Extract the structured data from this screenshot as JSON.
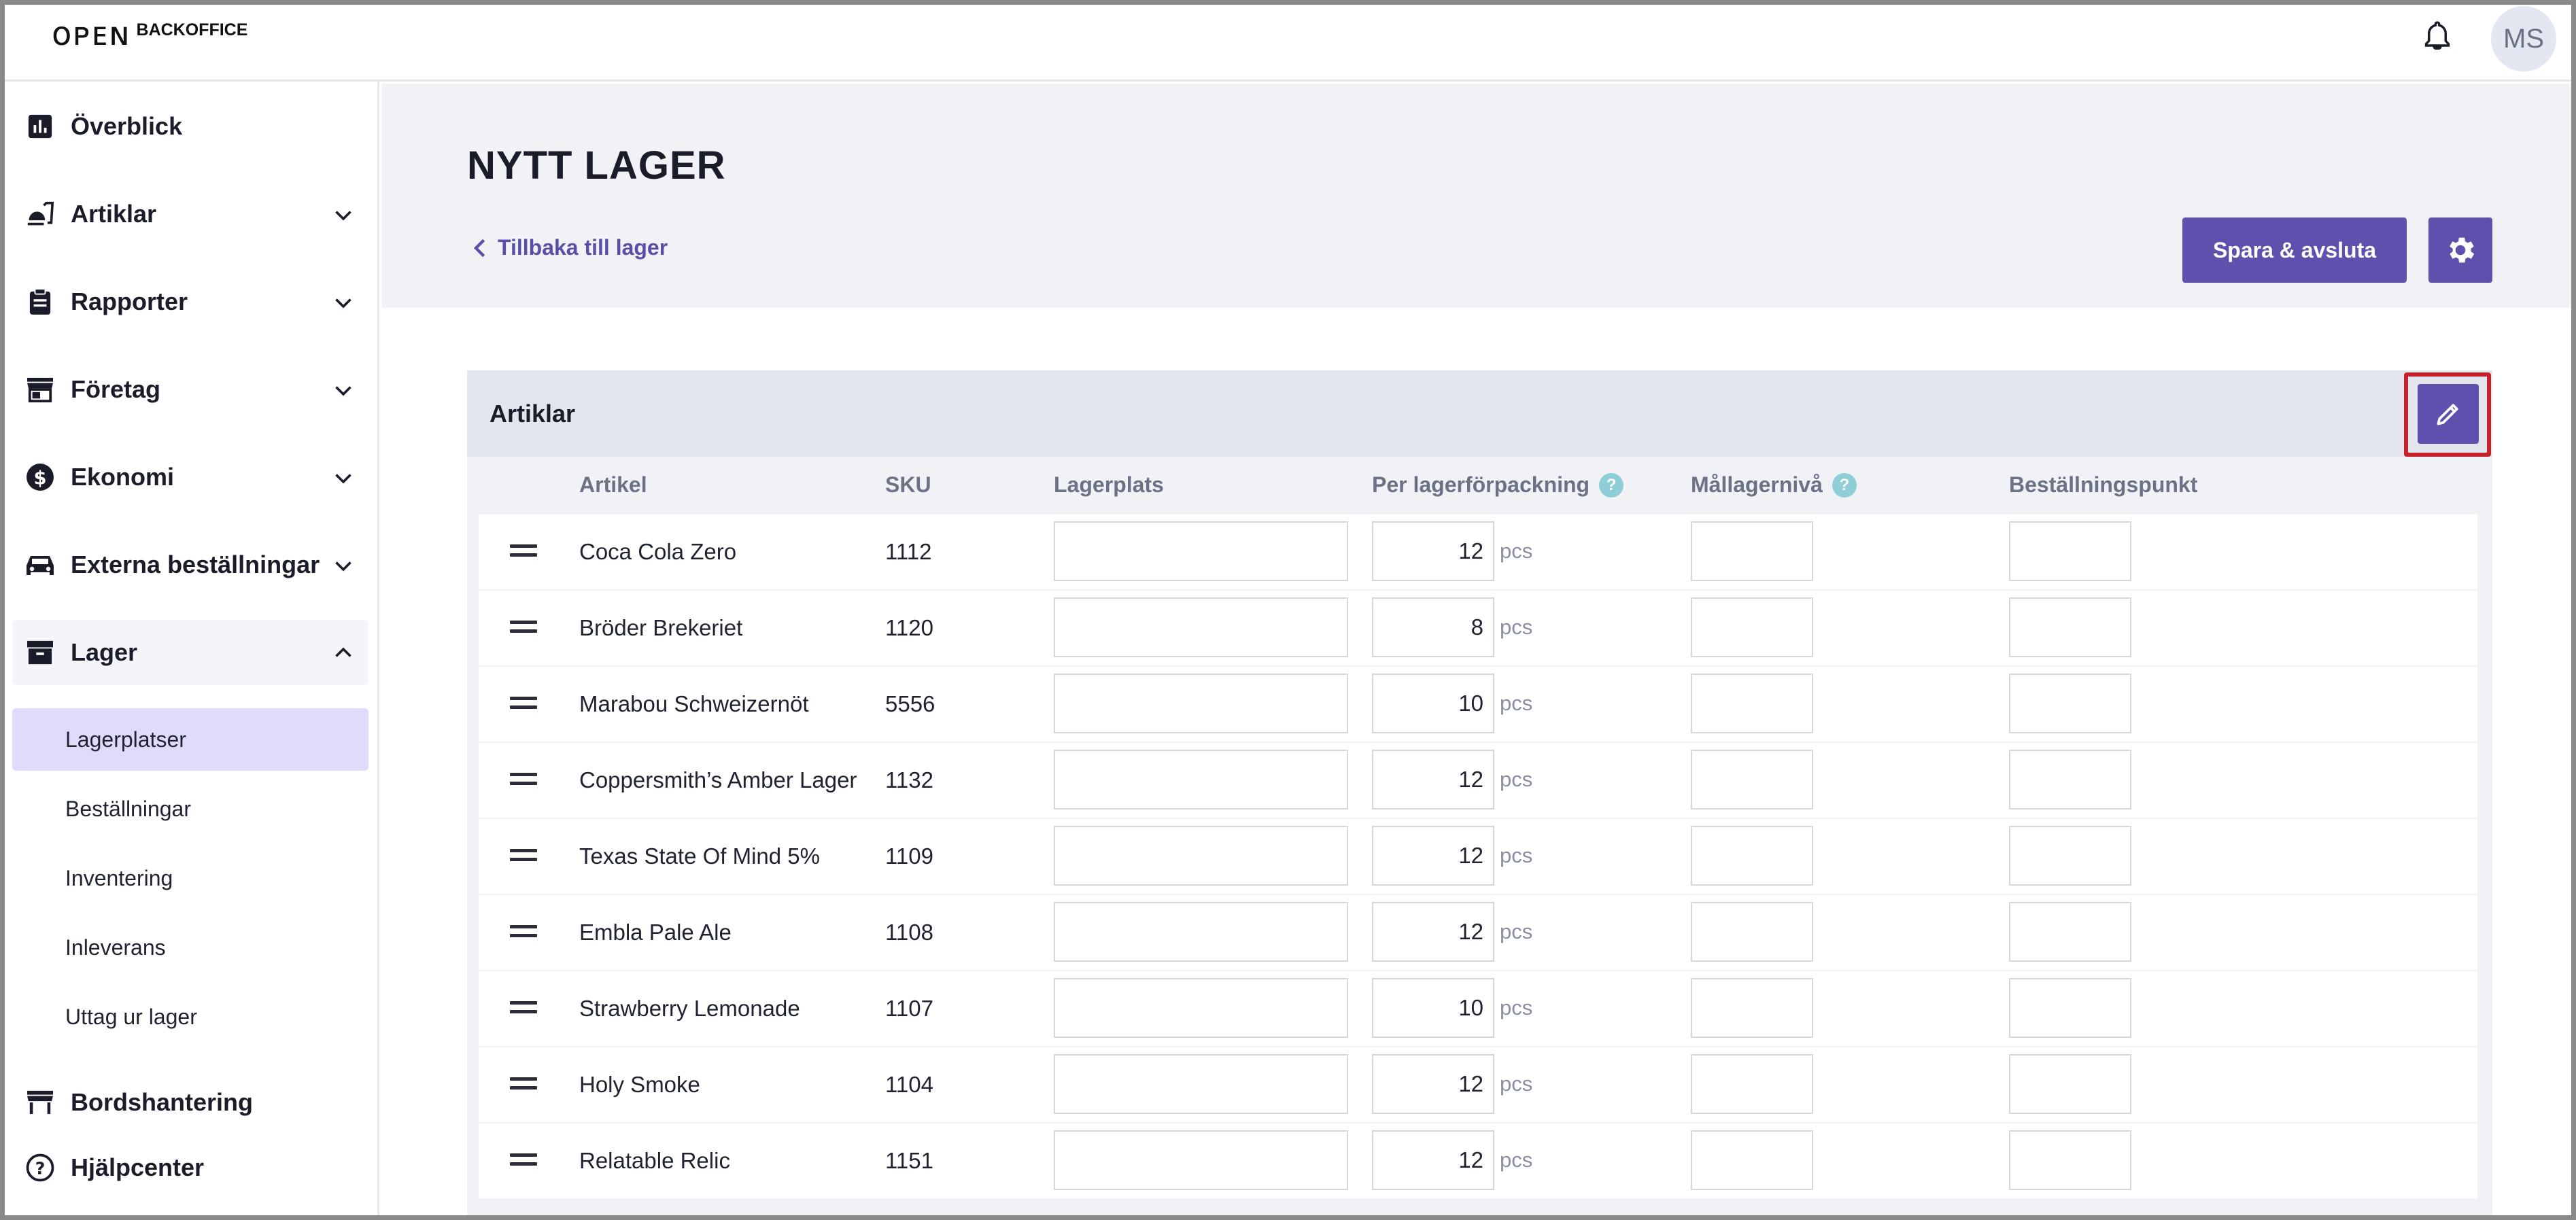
{
  "header": {
    "logo_mark": "ᴏᴘᴇɴ",
    "logo_text": "BACKOFFICE",
    "avatar_initials": "MS"
  },
  "sidebar": {
    "items": [
      {
        "label": "Överblick",
        "icon": "chart-icon"
      },
      {
        "label": "Artiklar",
        "icon": "food-icon"
      },
      {
        "label": "Rapporter",
        "icon": "clipboard-icon"
      },
      {
        "label": "Företag",
        "icon": "store-icon"
      },
      {
        "label": "Ekonomi",
        "icon": "dollar-icon"
      },
      {
        "label": "Externa beställningar",
        "icon": "car-icon"
      },
      {
        "label": "Lager",
        "icon": "archive-icon"
      }
    ],
    "lager_sub": [
      "Lagerplatser",
      "Beställningar",
      "Inventering",
      "Inleverans",
      "Uttag ur lager"
    ],
    "bottom": [
      {
        "label": "Bordshantering",
        "icon": "table-icon"
      },
      {
        "label": "Hjälpcenter",
        "icon": "help-icon"
      }
    ]
  },
  "page": {
    "title": "NYTT LAGER",
    "back_label": "Tillbaka till lager",
    "save_label": "Spara & avsluta"
  },
  "card": {
    "title": "Artiklar",
    "columns": {
      "article": "Artikel",
      "sku": "SKU",
      "location": "Lagerplats",
      "per_pack": "Per lagerförpackning",
      "target": "Mållagernivå",
      "order_point": "Beställningspunkt"
    },
    "help_glyph": "?",
    "unit": "pcs",
    "rows": [
      {
        "name": "Coca Cola Zero",
        "sku": "1112",
        "per": "12"
      },
      {
        "name": "Bröder Brekeriet",
        "sku": "1120",
        "per": "8"
      },
      {
        "name": "Marabou Schweizernöt",
        "sku": "5556",
        "per": "10"
      },
      {
        "name": "Coppersmith’s Amber Lager",
        "sku": "1132",
        "per": "12"
      },
      {
        "name": "Texas State Of Mind 5%",
        "sku": "1109",
        "per": "12"
      },
      {
        "name": "Embla Pale Ale",
        "sku": "1108",
        "per": "12"
      },
      {
        "name": "Strawberry Lemonade",
        "sku": "1107",
        "per": "10"
      },
      {
        "name": "Holy Smoke",
        "sku": "1104",
        "per": "12"
      },
      {
        "name": "Relatable Relic",
        "sku": "1151",
        "per": "12"
      }
    ]
  },
  "colors": {
    "accent": "#5e50ad",
    "highlight_border": "#c4222a",
    "active_sub_bg": "#e1dbfb"
  }
}
